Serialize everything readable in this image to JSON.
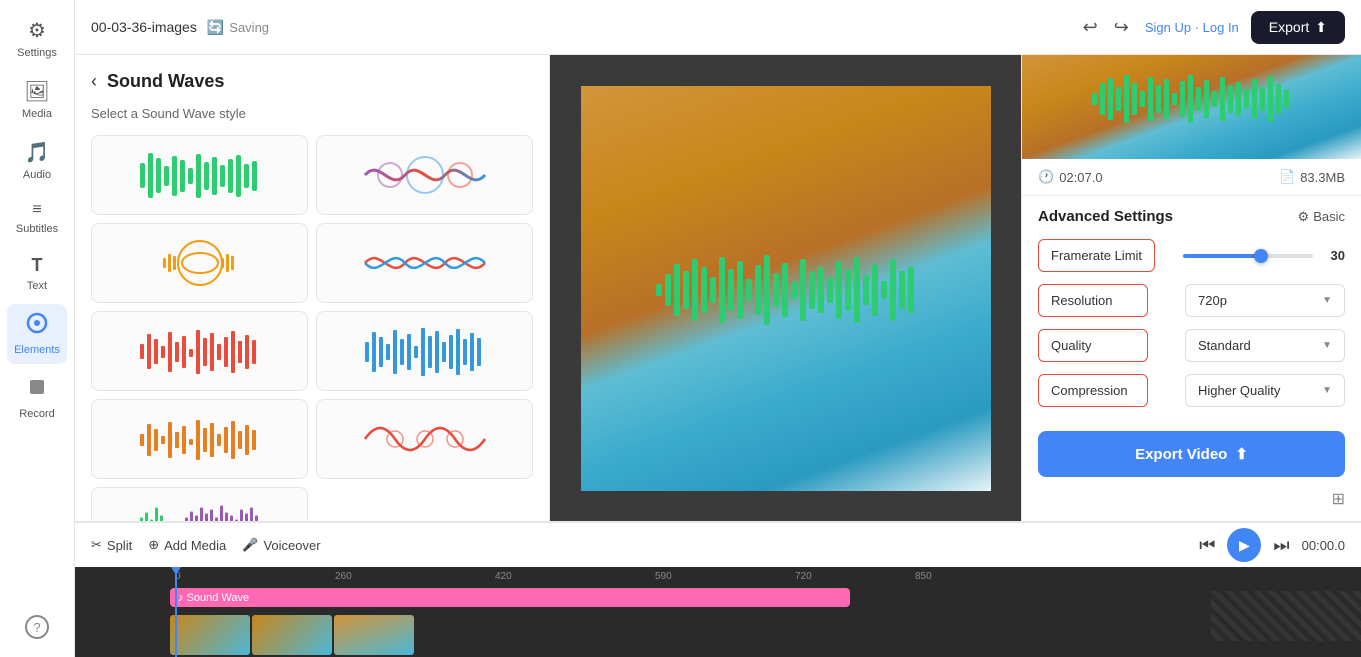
{
  "sidebar": {
    "items": [
      {
        "id": "settings",
        "label": "Settings",
        "icon": "⚙",
        "active": false
      },
      {
        "id": "media",
        "label": "Media",
        "icon": "🖼",
        "active": false
      },
      {
        "id": "audio",
        "label": "Audio",
        "icon": "♪",
        "active": false
      },
      {
        "id": "subtitles",
        "label": "Subtitles",
        "icon": "▤",
        "active": false
      },
      {
        "id": "text",
        "label": "Text",
        "icon": "T",
        "active": false
      },
      {
        "id": "elements",
        "label": "Elements",
        "icon": "◎",
        "active": true
      },
      {
        "id": "record",
        "label": "Record",
        "icon": "⬛",
        "active": false
      },
      {
        "id": "more",
        "label": "?",
        "icon": "?",
        "active": false
      }
    ]
  },
  "topbar": {
    "project_name": "00-03-36-images",
    "saving_text": "Saving",
    "undo_label": "↩",
    "redo_label": "↪",
    "auth_text": "Sign Up · Log In",
    "export_label": "Export"
  },
  "left_panel": {
    "back_label": "←",
    "title": "Sound Waves",
    "subtitle": "Select a Sound Wave style"
  },
  "export_panel": {
    "duration": "02:07.0",
    "file_size": "83.3MB",
    "settings_title": "Advanced Settings",
    "basic_label": "Basic",
    "framerate_label": "Framerate Limit",
    "framerate_value": "30",
    "resolution_label": "Resolution",
    "resolution_value": "720p",
    "quality_label": "Quality",
    "quality_value": "Standard",
    "compression_label": "Compression",
    "compression_value": "Higher Quality",
    "export_video_label": "Export Video"
  },
  "timeline": {
    "split_label": "Split",
    "add_media_label": "Add Media",
    "voiceover_label": "Voiceover",
    "time_display": "00:00.0",
    "sound_wave_track_label": "♪ Sound Wave",
    "ruler_marks": [
      "0",
      "260",
      "420",
      "590",
      "720",
      "850"
    ]
  }
}
